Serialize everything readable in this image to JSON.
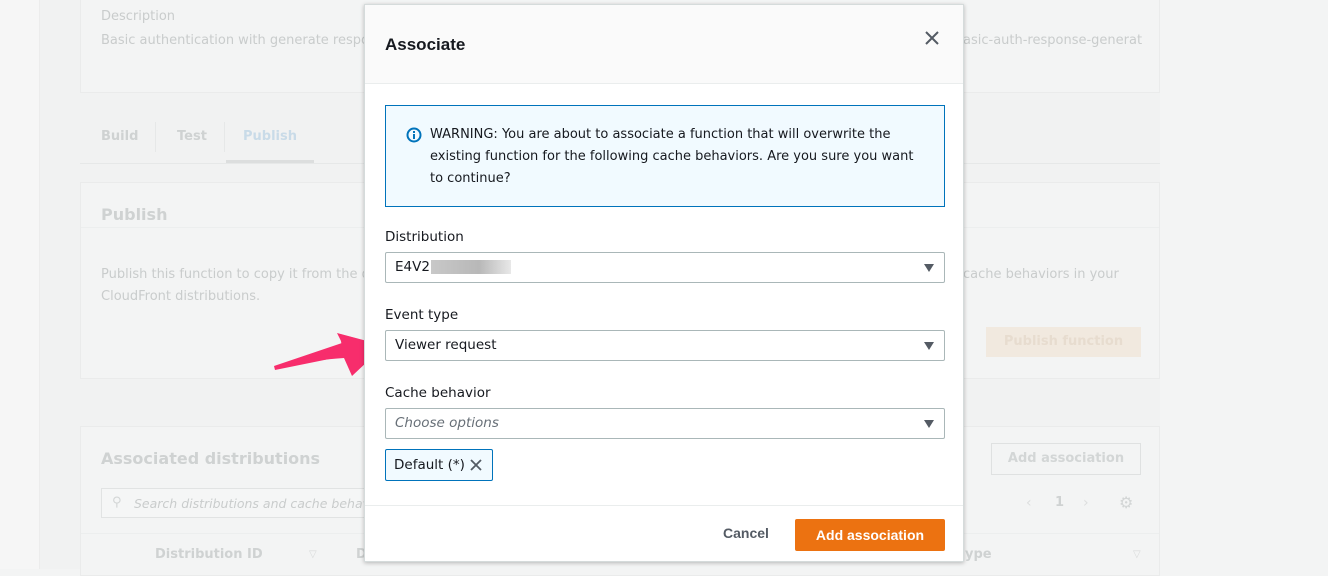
{
  "background": {
    "description_label": "Description",
    "description_value": "Basic authentication with generate respon",
    "name_value": "asic-auth-response-generat",
    "tabs": [
      "Build",
      "Test",
      "Publish"
    ],
    "publish_title": "Publish",
    "publish_text_1": "Publish this function to copy it from the d",
    "publish_text_1b": "cache behaviors in your",
    "publish_text_2": "CloudFront distributions.",
    "publish_button": "Publish function",
    "assoc_title": "Associated distributions",
    "add_association": "Add association",
    "search_placeholder": "Search distributions and cache behav",
    "page_number": "1",
    "col_distribution_id": "Distribution ID",
    "col_d": "D",
    "col_type": "ype"
  },
  "modal": {
    "title": "Associate",
    "warning": "WARNING: You are about to associate a function that will overwrite the existing function for the following cache behaviors. Are you sure you want to continue?",
    "distribution_label": "Distribution",
    "distribution_value": "E4V2",
    "event_type_label": "Event type",
    "event_type_value": "Viewer request",
    "cache_behavior_label": "Cache behavior",
    "cache_behavior_placeholder": "Choose options",
    "token": "Default (*)",
    "cancel": "Cancel",
    "add": "Add association"
  },
  "colors": {
    "primary": "#ec7211",
    "info_border": "#0073bb",
    "arrow": "#f72d6c"
  }
}
